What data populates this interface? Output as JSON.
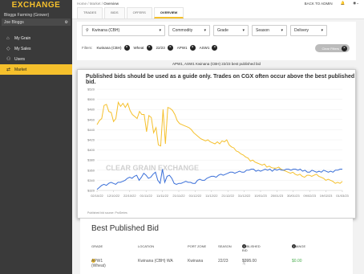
{
  "sidebar": {
    "logo": "EXCHANGE",
    "org": "Bloggs Farming (Grower)",
    "user": "Joe Bloggs",
    "items": [
      {
        "label": "My Grain"
      },
      {
        "label": "My Sales"
      },
      {
        "label": "Users"
      },
      {
        "label": "Market"
      }
    ]
  },
  "header": {
    "breadcrumb_prefix": "Home / Market / ",
    "breadcrumb_current": "Overview",
    "back_link": "BACK TO ADMIN",
    "tabs": [
      "TRADES",
      "BIDS",
      "OFFERS",
      "OVERVIEW"
    ]
  },
  "filters": {
    "location": "Kwinana (CBH)",
    "commodity": "Commodity",
    "grade": "Grade",
    "season": "Season",
    "delivery": "Delivery",
    "label": "Filters:",
    "chips": [
      "Kwinana (CBH)",
      "Wheat",
      "22/23",
      "APW1",
      "ASW1"
    ],
    "clear": "Clear Filters"
  },
  "chart_heading": "APW1, ASW1 Kwinana (CBH) 22/23 best published bid",
  "notice": "Published bids should be used as a guide only. Trades on CGX often occur above the best published bid.",
  "watermark": "CLEAR GRAIN EXCHANGE",
  "source": "Published bid source: ProSeries",
  "chart_data": {
    "type": "line",
    "x": [
      "02/10/22",
      "12/10/22",
      "22/10/22",
      "01/11/22",
      "11/11/22",
      "21/11/22",
      "01/12/22",
      "11/12/22",
      "21/12/22",
      "31/12/22",
      "10/01/23",
      "20/01/23",
      "30/01/23",
      "09/02/23",
      "19/02/23",
      "01/03/23"
    ],
    "x_ticks": [
      "02/10/22",
      "12/10/22",
      "22/10/22",
      "01/11/22",
      "11/11/22",
      "21/11/22",
      "01/12/22",
      "11/12/22",
      "21/12/22",
      "31/12/22",
      "10/01/23",
      "20/01/23",
      "30/01/23",
      "09/02/23",
      "19/02/23",
      "01/03/23"
    ],
    "y_ticks": [
      "$320",
      "$340",
      "$360",
      "$380",
      "$400",
      "$420",
      "$440",
      "$460",
      "$480",
      "$500",
      "$520"
    ],
    "ylim": [
      320,
      520
    ],
    "series": [
      {
        "color": "#f5c02c",
        "values": [
          450,
          458,
          462,
          488,
          490,
          476,
          474,
          456,
          462,
          494,
          486,
          492,
          484,
          492,
          478,
          470,
          466,
          462,
          476,
          470,
          470,
          436,
          468,
          464,
          434,
          444,
          410,
          408,
          480,
          412,
          484,
          482,
          478,
          470,
          458,
          452,
          450,
          448,
          446,
          444,
          440,
          434,
          430,
          426,
          422,
          420,
          418,
          420,
          416,
          414,
          412,
          416,
          412,
          418,
          416,
          420,
          410,
          406,
          404,
          398,
          396,
          392,
          390,
          386,
          384,
          378,
          380,
          376,
          374,
          372,
          370,
          372,
          366,
          368,
          365,
          364,
          364,
          366,
          362,
          360,
          358,
          356,
          354,
          356,
          352,
          350,
          352,
          348,
          346,
          350,
          350,
          348,
          350,
          352,
          348,
          346,
          344,
          340,
          342,
          340,
          338,
          334,
          336,
          334,
          338
        ]
      },
      {
        "color": "#3a6fd8",
        "values": [
          322,
          326,
          330,
          332,
          330,
          334,
          336,
          334,
          332,
          336,
          336,
          338,
          340,
          344,
          346,
          344,
          348,
          350,
          340,
          346,
          354,
          350,
          344,
          346,
          352,
          356,
          340,
          334,
          362,
          336,
          348,
          350,
          344,
          334,
          332,
          334,
          334,
          336,
          338,
          336,
          336,
          334,
          334,
          340,
          342,
          340,
          340,
          344,
          346,
          348,
          348,
          346,
          350,
          352,
          350,
          352,
          354,
          356,
          356,
          354,
          356,
          358,
          356,
          356,
          360,
          360,
          362,
          362,
          358,
          360,
          358,
          360,
          362,
          360,
          362,
          358,
          362,
          360,
          362,
          360,
          360,
          362,
          362,
          360,
          362,
          362,
          360,
          362,
          358,
          360,
          356,
          356,
          360,
          358,
          356,
          358,
          356,
          360,
          358,
          356,
          358,
          356,
          360,
          360,
          362,
          362
        ]
      }
    ]
  },
  "best_bid": {
    "title": "Best Published Bid",
    "headers": {
      "grade": "GRADE",
      "location": "LOCATION",
      "port": "PORT ZONE",
      "season": "SEASON",
      "published": "PUBLISHED BID",
      "change": "CHANGE"
    },
    "row": {
      "grade": "APW1 (Wheat)",
      "location": "Kwinana (CBH) WA",
      "port": "Kwinana",
      "season": "22/23",
      "bid": "$395.00",
      "bid_sub": "(ASW1 -$)",
      "change": "$0.00"
    }
  },
  "colors": {
    "accent": "#f5c02c",
    "blue": "#3a6fd8"
  }
}
